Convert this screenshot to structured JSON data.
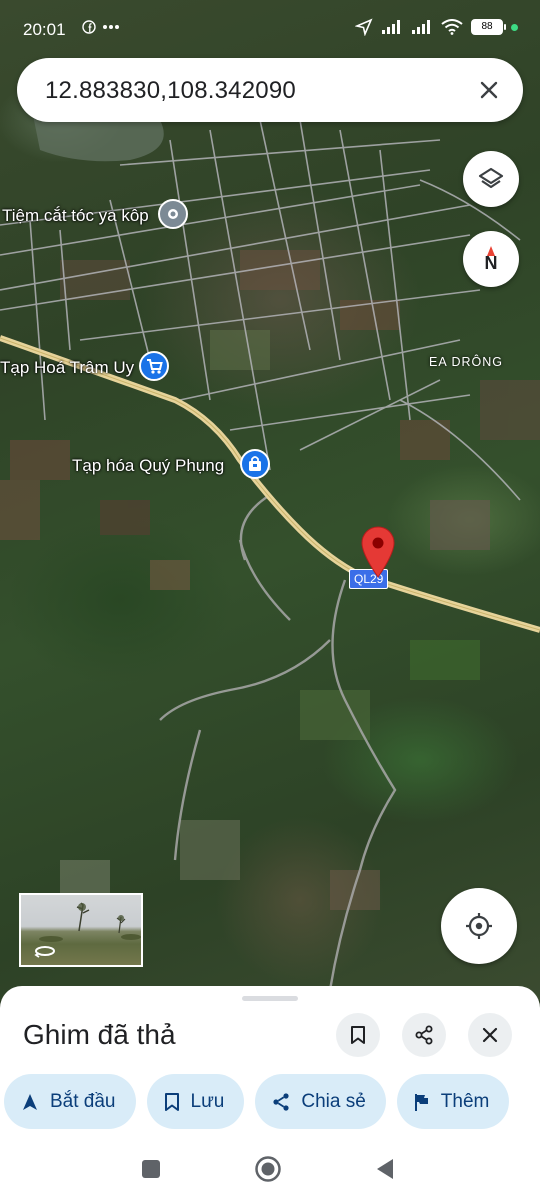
{
  "status_bar": {
    "time": "20:01",
    "left_icons": [
      "facebook-icon",
      "more-dots-icon"
    ],
    "battery": "88",
    "right_icons": [
      "location-arrow-icon",
      "signal-icon",
      "signal-icon",
      "wifi-icon",
      "battery-icon"
    ]
  },
  "search": {
    "value": "12.883830,108.342090",
    "clear_icon": "close-icon"
  },
  "map": {
    "labels": {
      "barber": "Tiệm cắt tóc ya kôp",
      "grocery1": "Tạp Hoá Trâm Uy",
      "grocery2": "Tạp hóa Quý Phụng",
      "area": "EA DRÔNG"
    },
    "route_shield": "QL29",
    "compass": "N",
    "colors": {
      "pin": "#e53935",
      "poi_blue": "#1a73e8",
      "poi_gray": "#7c8a95",
      "highway": "#e6d39a"
    }
  },
  "sheet": {
    "title": "Ghim đã thả",
    "chips": [
      {
        "label": "Bắt đầu",
        "icon": "navigate-arrow-icon"
      },
      {
        "label": "Lưu",
        "icon": "bookmark-icon"
      },
      {
        "label": "Chia sẻ",
        "icon": "share-icon"
      },
      {
        "label": "Thêm",
        "icon": "flag-icon"
      }
    ]
  },
  "navbar": {
    "buttons": [
      "recent-apps-icon",
      "home-icon",
      "back-icon"
    ]
  }
}
